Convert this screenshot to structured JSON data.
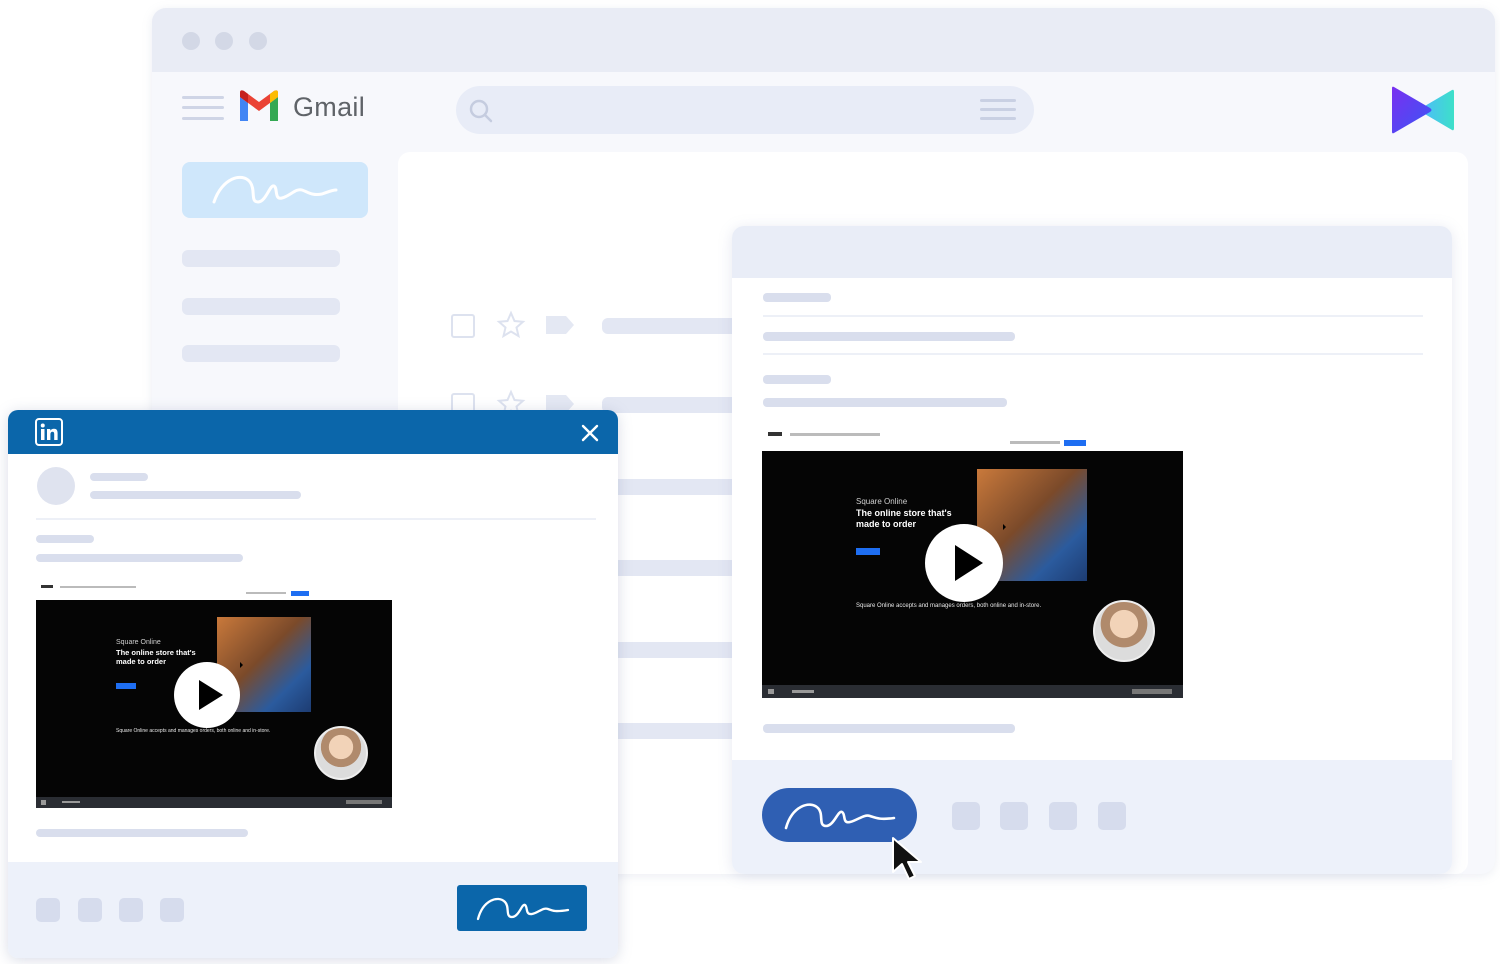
{
  "gmail": {
    "app_name": "Gmail",
    "icons": {
      "menu": "hamburger-icon",
      "logo": "gmail-logo-icon",
      "search": "search-icon",
      "filter": "filter-icon",
      "brand": "video-brand-icon"
    },
    "compose_button_icon": "signature-icon",
    "sidebar_items": 3,
    "email_list_rows": 2,
    "email_list_row_icons": [
      "checkbox-icon",
      "star-icon",
      "label-icon"
    ]
  },
  "email_compose": {
    "send_button_icon": "signature-icon",
    "toolbar_icons": 4,
    "video": {
      "brand": "Square Online",
      "headline": "The online store that's made to order",
      "caption": "Square Online accepts and manages orders, both online and in-store.",
      "play_icon": "play-icon",
      "presenter_avatar": "presenter-avatar"
    }
  },
  "linkedin_post": {
    "header_icon": "linkedin-icon",
    "close_icon": "close-icon",
    "post_button_icon": "signature-icon",
    "toolbar_icons": 4,
    "video": {
      "brand": "Square Online",
      "headline": "The online store that's made to order",
      "caption": "Square Online accepts and manages orders, both online and in-store.",
      "play_icon": "play-icon",
      "presenter_avatar": "presenter-avatar"
    }
  },
  "colors": {
    "linkedin_blue": "#0b66aa",
    "send_button_blue": "#2f5fb3",
    "compose_light_blue": "#cfe7fb",
    "gmail_red": "#ea4335",
    "placeholder_gray": "#e3e7f3"
  }
}
